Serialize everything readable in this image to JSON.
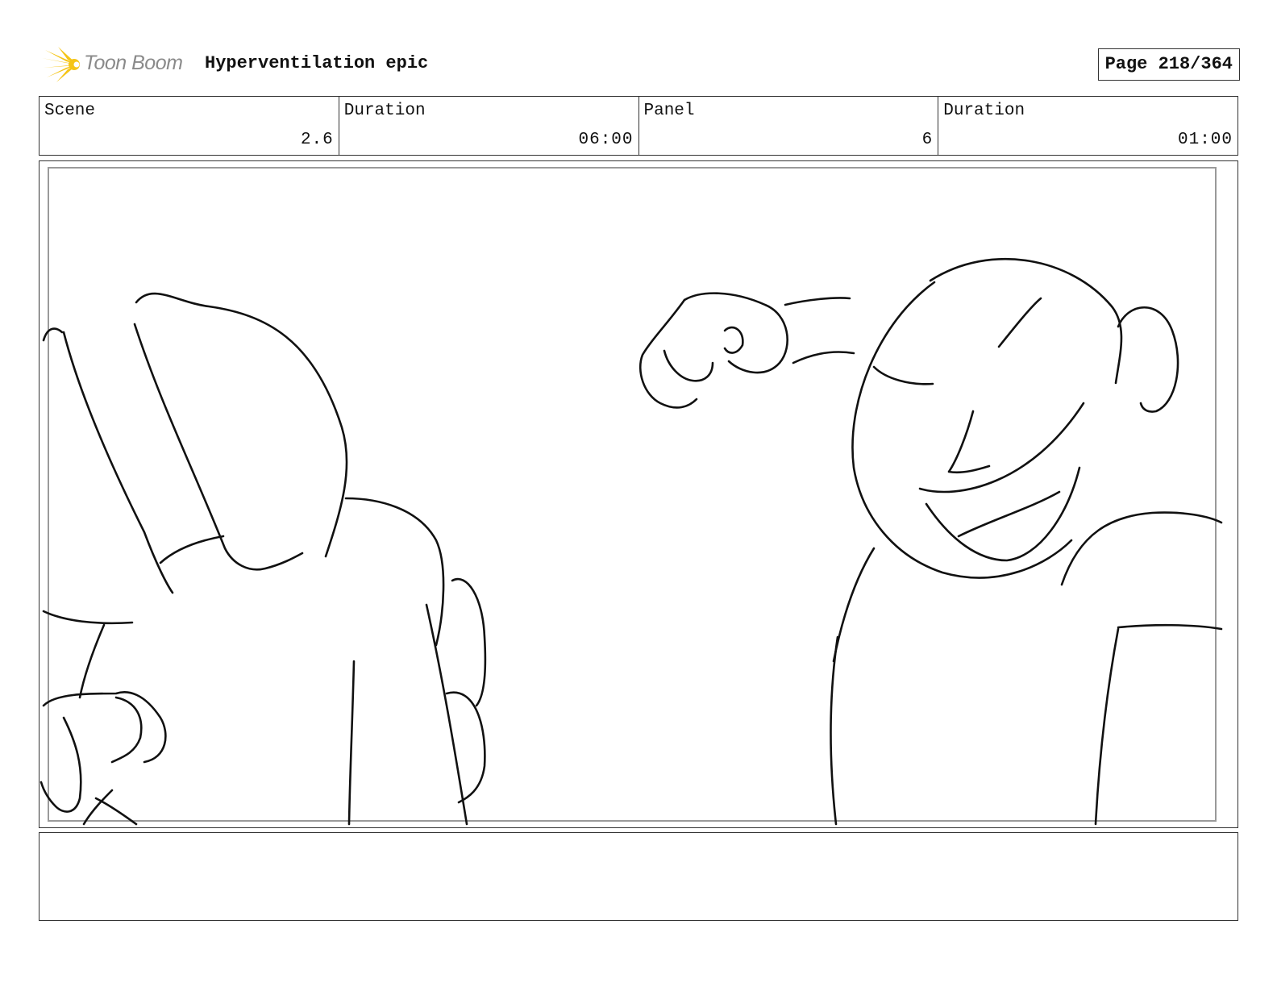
{
  "header": {
    "logo_text": "Toon Boom",
    "project_title": "Hyperventilation epic",
    "page_label": "Page 218/364"
  },
  "info": {
    "scene_label": "Scene",
    "scene_value": "2.6",
    "scene_duration_label": "Duration",
    "scene_duration_value": "06:00",
    "panel_label": "Panel",
    "panel_value": "6",
    "panel_duration_label": "Duration",
    "panel_duration_value": "01:00"
  },
  "caption": {
    "text": ""
  },
  "colors": {
    "logo_accent": "#f5c518",
    "logo_text": "#8a8a8a",
    "border": "#333333",
    "panel_inner_border": "#9a9a9a"
  }
}
